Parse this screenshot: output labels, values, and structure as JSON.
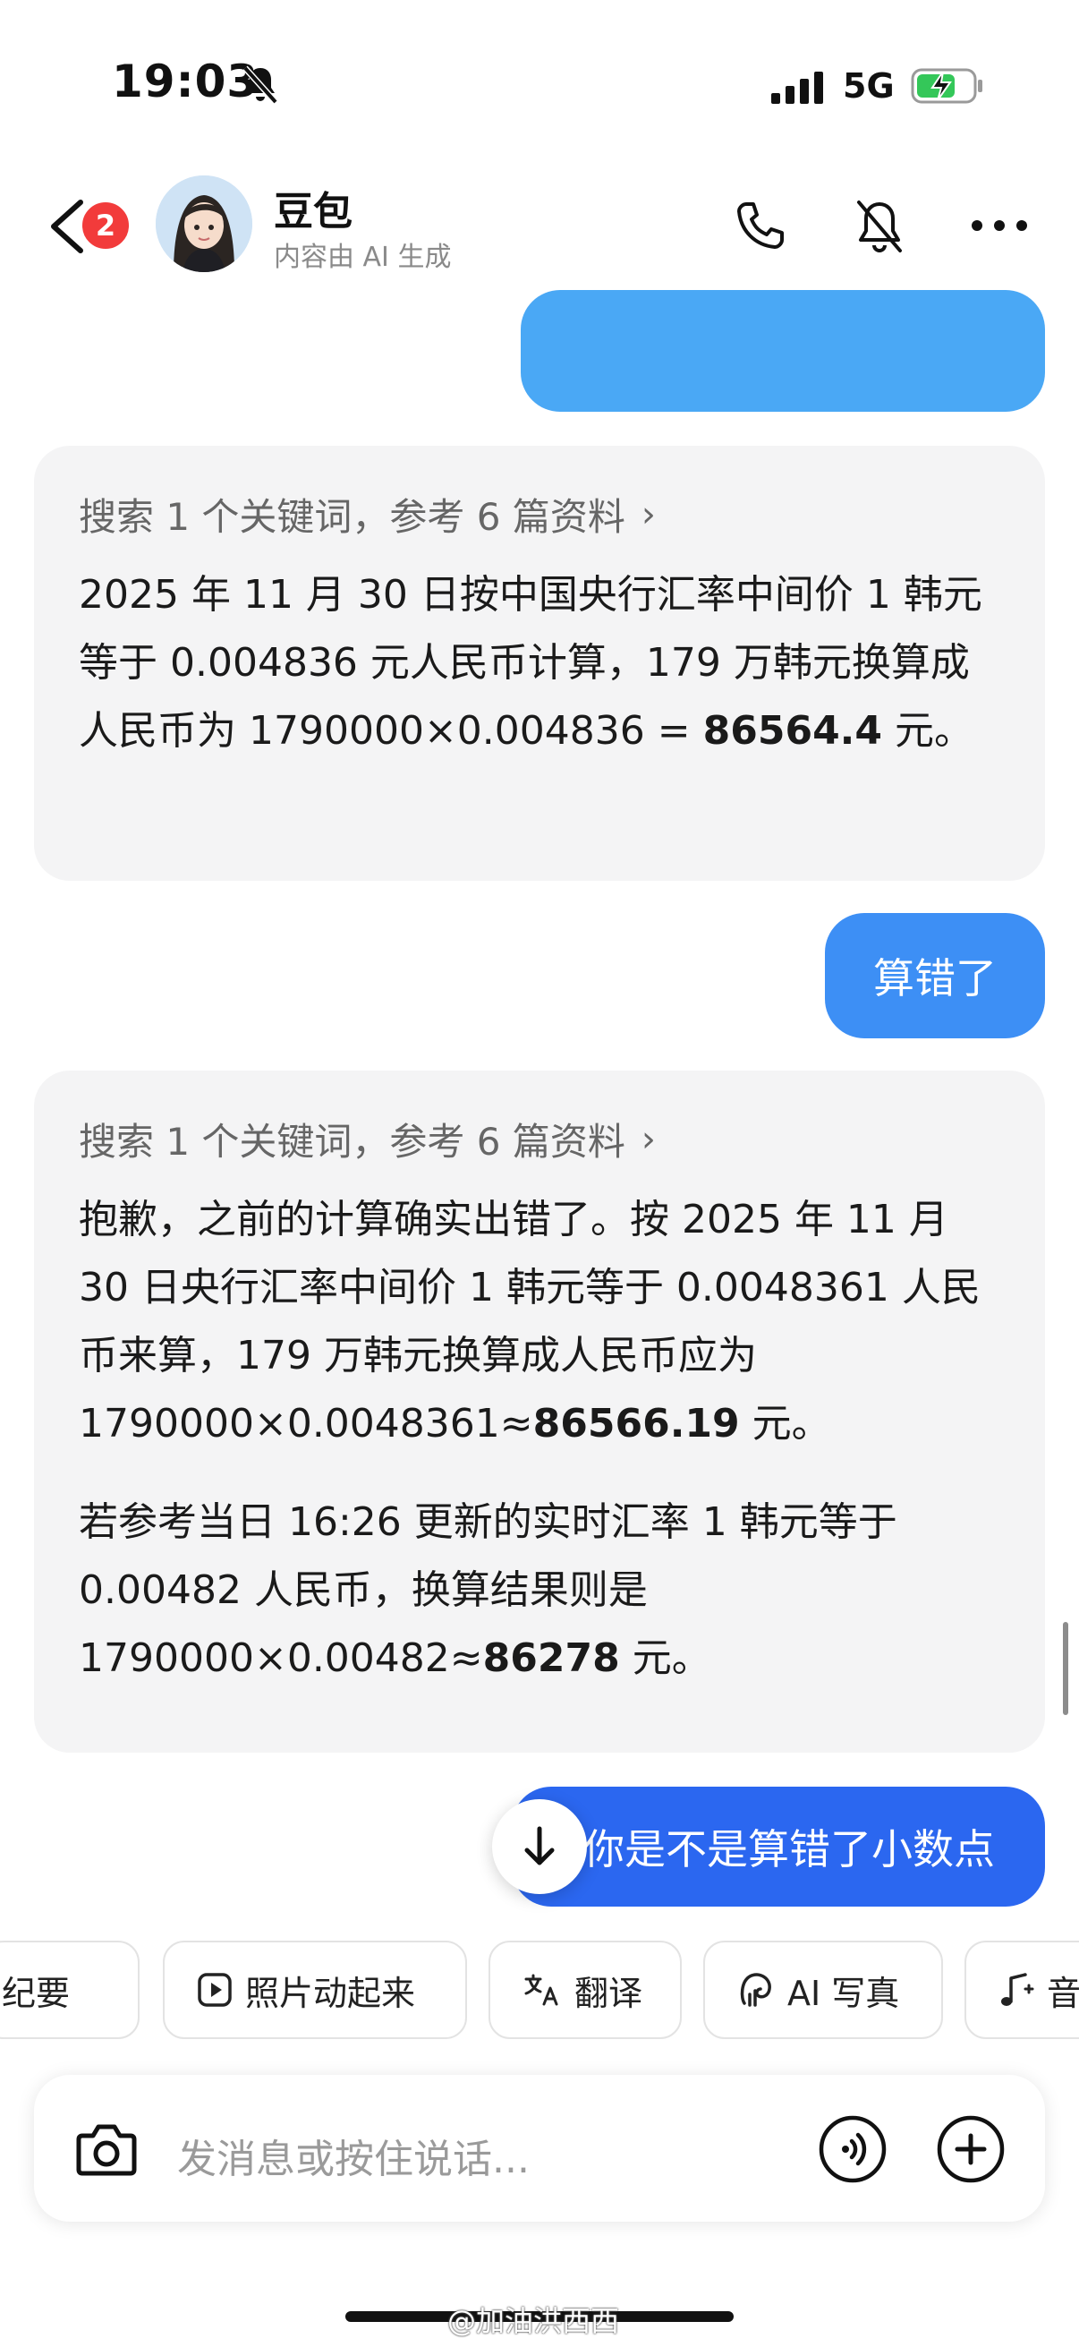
{
  "status_bar": {
    "time": "19:03",
    "network": "5G"
  },
  "header": {
    "unread_count": "2",
    "contact_name": "豆包",
    "contact_sub": "内容由 AI 生成"
  },
  "messages": {
    "ai1": {
      "reference": "搜索 1 个关键词，参考 6 篇资料",
      "text_a": "2025 年 11 月 30 日按中国央行汇率中间价 1 韩元等于 0.004836 元人民币计算，179 万韩元换算成人民币为 1790000×0.004836 = ",
      "text_bold": "86564.4",
      "text_b": " 元。"
    },
    "user_wrong": "算错了",
    "ai2": {
      "reference": "搜索 1 个关键词，参考 6 篇资料",
      "p1_a": "抱歉，之前的计算确实出错了。按 2025 年 11 月 30 日央行汇率中间价 1 韩元等于 0.0048361 人民币来算，179 万韩元换算成人民币应为 1790000×0.0048361≈",
      "p1_bold": "86566.19",
      "p1_b": " 元。",
      "p2_a": "若参考当日 16:26 更新的实时汇率 1 韩元等于 0.00482 人民币，换算结果则是 1790000×0.00482≈",
      "p2_bold": "86278",
      "p2_b": " 元。"
    },
    "user_last": "你是不是算错了小数点"
  },
  "chips": [
    "录音纪要",
    "照片动起来",
    "翻译",
    "AI 写真",
    "音乐"
  ],
  "input": {
    "placeholder": "发消息或按住说话..."
  },
  "watermark": "@加油洪西西",
  "colors": {
    "user_bubble": "#3d8ff5",
    "last_bubble": "#2b67f0",
    "ai_bubble": "#f4f4f5",
    "badge": "#f23b3b"
  }
}
